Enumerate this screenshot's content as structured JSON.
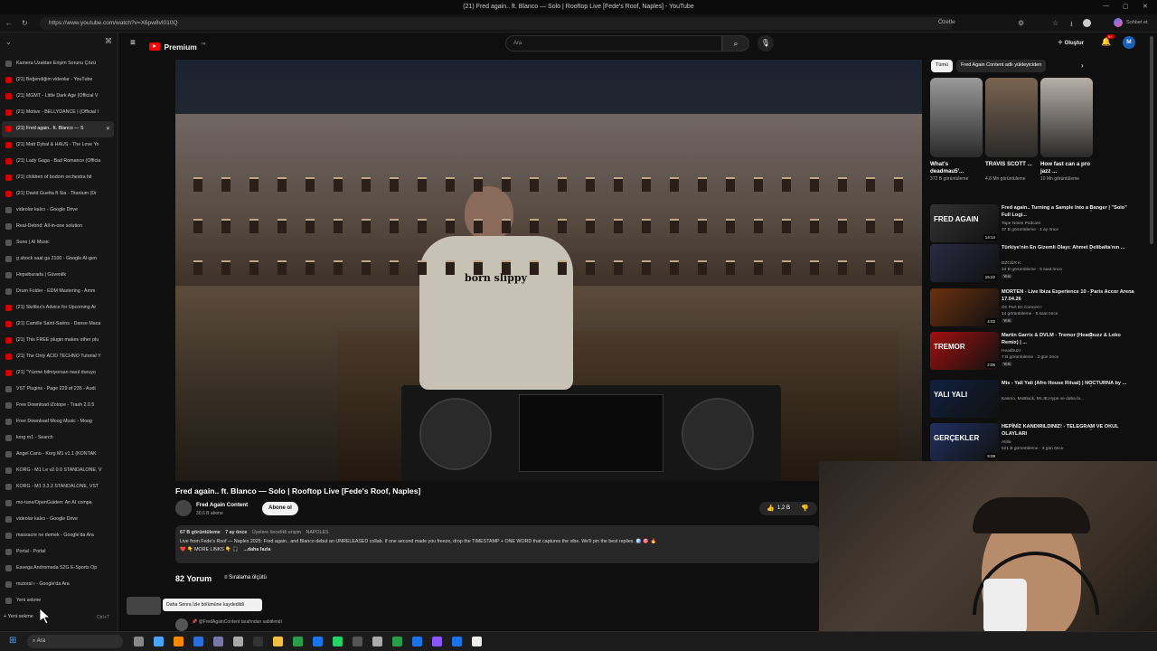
{
  "browser": {
    "window_title": "(21) Fred again.. ft. Blanco — Solo | Rooftop Live [Fede's Roof, Naples] - YouTube",
    "url": "https://www.youtube.com/watch?v=X6pw8vI010Q",
    "ozette_label": "Özetle",
    "chat_label": "Sohbet et"
  },
  "sidebar": {
    "tabs": [
      {
        "label": "Kamera Uzaktan Erişim Sorunu Çözü",
        "icon": "generic",
        "active": false
      },
      {
        "label": "(21) Beğendiğim videolar - YouTube",
        "icon": "youtube",
        "active": false
      },
      {
        "label": "(21) MGMT - Little Dark Age (Official V",
        "icon": "youtube",
        "active": false
      },
      {
        "label": "(21) Motive - BELLYDANCE | (Official I",
        "icon": "youtube",
        "active": false
      },
      {
        "label": "(21) Fred again.. ft. Blanco — S",
        "icon": "youtube",
        "active": true
      },
      {
        "label": "(21) Matt Dybal & HAUS - The Love Yo",
        "icon": "youtube",
        "active": false
      },
      {
        "label": "(21) Lady Gaga - Bad Romance (Officia",
        "icon": "youtube",
        "active": false
      },
      {
        "label": "(21) children of bodom orchestra hit",
        "icon": "youtube",
        "active": false
      },
      {
        "label": "(21) David Guetta ft Sia - Titanium (Dr",
        "icon": "youtube",
        "active": false
      },
      {
        "label": "videolar kalıcı - Google Drive",
        "icon": "generic",
        "active": false
      },
      {
        "label": "Real-Debrid: All-in-one solution",
        "icon": "generic",
        "active": false
      },
      {
        "label": "Suno | AI Music",
        "icon": "generic",
        "active": false
      },
      {
        "label": "g shock saat ga 2100 - Google AI-gen",
        "icon": "generic",
        "active": false
      },
      {
        "label": "Hepsiburada | Güvenlik",
        "icon": "generic",
        "active": false
      },
      {
        "label": "Drum Folder - EDM Mastering - Amm",
        "icon": "generic",
        "active": false
      },
      {
        "label": "(21) Skrillex's Advice for Upcoming Ar",
        "icon": "youtube",
        "active": false
      },
      {
        "label": "(21) Camille Saint-Saëns - Danse Maca",
        "icon": "youtube",
        "active": false
      },
      {
        "label": "(21) This FREE plugin makes other plu",
        "icon": "youtube",
        "active": false
      },
      {
        "label": "(21) The Only ACID TECHNO Tutorial Y",
        "icon": "youtube",
        "active": false
      },
      {
        "label": "(21) \"Yüzme bilmiyorsan nasıl duruyo",
        "icon": "youtube",
        "active": false
      },
      {
        "label": "VST Plugins - Page 229 of 235 - Audi",
        "icon": "generic",
        "active": false
      },
      {
        "label": "Free Download iZotope - Trash 2.0.5",
        "icon": "generic",
        "active": false
      },
      {
        "label": "Free Download Moog Music - Moog",
        "icon": "generic",
        "active": false
      },
      {
        "label": "korg m1 - Search",
        "icon": "generic",
        "active": false
      },
      {
        "label": "Angel Cano - Korg M1 v1.1 (KONTAK",
        "icon": "generic",
        "active": false
      },
      {
        "label": "KORG - M1 Le v2.0.0 STANDALONE, V",
        "icon": "generic",
        "active": false
      },
      {
        "label": "KORG - M1 3.3.2 STANDALONE, VST",
        "icon": "generic",
        "active": false
      },
      {
        "label": "mo-tune/OpenGuiden: An AI compa",
        "icon": "generic",
        "active": false
      },
      {
        "label": "videolar kalıcı - Google Drive",
        "icon": "generic",
        "active": false
      },
      {
        "label": "massacre ne demek - Google'da Ara",
        "icon": "generic",
        "active": false
      },
      {
        "label": "Portal - Portal",
        "icon": "generic",
        "active": false
      },
      {
        "label": "Eavega Andromeda S2G E-Sports Op",
        "icon": "generic",
        "active": false
      },
      {
        "label": "mutoral ı - Google'da Ara",
        "icon": "generic",
        "active": false
      },
      {
        "label": "Yeni sekme",
        "icon": "generic",
        "active": false
      }
    ],
    "new_tab_label": "Yeni sekme",
    "new_tab_shortcut": "Ctrl+T"
  },
  "youtube_header": {
    "logo": "Premium",
    "logo_sup": "TR",
    "search_placeholder": "Ara",
    "create_label": "Oluştur",
    "notif_count": "9+",
    "avatar_letter": "M"
  },
  "video": {
    "title": "Fred again.. ft. Blanco — Solo | Rooftop Live [Fede's Roof, Naples]",
    "shirt_text": "born slippy",
    "channel": "Fred Again Content",
    "subscribers": "30,6 B abone",
    "subscribe_label": "Abone ol",
    "likes": "1,2 B",
    "views": "67 B görüntüleme",
    "age": "7 ay önce",
    "early_access": "Üyelere öncelikli erişim",
    "tag": "NAPOLES",
    "description": "Live from Fede's Roof — Naples 2025: Fred again.. and Blanco debut an UNRELEASED collab. If one second made you freeze, drop the TIMESTAMP + ONE WORD that captures the vibe. We'll pin the best replies. 🪩 🎯 🔥",
    "more_links": "❤️ 👇 MORE LINKS 👇 🎧",
    "more_label": "...daha fazla",
    "comments_count": "82 Yorum",
    "sort_label": "Sıralama ölçütü",
    "pinned_note": "@FredAgainContent tarafından sabitlendi"
  },
  "toast": {
    "text": "Daha Sonra İzle bölümüne kaydedildi"
  },
  "chips": {
    "all": "Tümü",
    "channel": "Fred Again Content adlı yükleyiciden"
  },
  "shorts": [
    {
      "title": "What's deadmau5'...",
      "views": "372 B görüntüleme",
      "color": "#9a9a9a"
    },
    {
      "title": "TRAVIS SCOTT ...",
      "views": "4,8 Mn görüntüleme",
      "color": "#7a6450"
    },
    {
      "title": "How fast can a pro jazz ...",
      "views": "10 Mn görüntüleme",
      "color": "#b8b0a8"
    }
  ],
  "recommendations": [
    {
      "title": "Fred again.. Turning a Sample Into a Banger | \"Solo\" Full Logi...",
      "channel": "Tape Notes Podcast",
      "meta": "37 B görüntüleme · 1 ay önce",
      "duration": "14:14",
      "color": "#333",
      "badge": ""
    },
    {
      "title": "Türkiye'nin En Gizemli Olayı: Ahmet Delibalta'nın ...",
      "channel": "DZCÜR K",
      "meta": "34 B görüntüleme · 5 saat önce",
      "duration": "15:22",
      "color": "#2a2a44",
      "badge": "Yeni"
    },
    {
      "title": "MORTEN - Live Ibiza Experience 10 - Paris Accor Arena 17.04.26",
      "channel": "On Part En Concert !",
      "meta": "14 görüntüleme · 5 saat önce",
      "duration": "4:02",
      "color": "#6a3010",
      "badge": "Yeni"
    },
    {
      "title": "Martin Garrix & DVLM - Tremor (Headbuzz & Loko Remix) | ...",
      "channel": "Headbuzz",
      "meta": "7 B görüntüleme · 3 gün önce",
      "duration": "2:06",
      "color": "#a01010",
      "badge": "Yeni"
    },
    {
      "title": "Mix - Yali Yali (Afro House Ritual) | NOCTURNA by ...",
      "channel": "Kasmo, MoBlack, Mr.JE,Hype ve daha fa...",
      "meta": "",
      "duration": "",
      "color": "#102040",
      "badge": ""
    },
    {
      "title": "HEPİNİZ KANDIRILDINIZ! - TELEGRAM VE OKUL OLAYLARI",
      "channel": "Atilla",
      "meta": "521 B görüntüleme · 3 gün önce",
      "duration": "9:09",
      "color": "#203060",
      "badge": ""
    }
  ],
  "thumbnail_texts": {
    "rec1": "FRED AGAIN",
    "rec4": "TREMOR",
    "rec5": "YALI YALI",
    "rec6": "GERÇEKLER"
  },
  "taskbar": {
    "search_label": "Ara"
  }
}
